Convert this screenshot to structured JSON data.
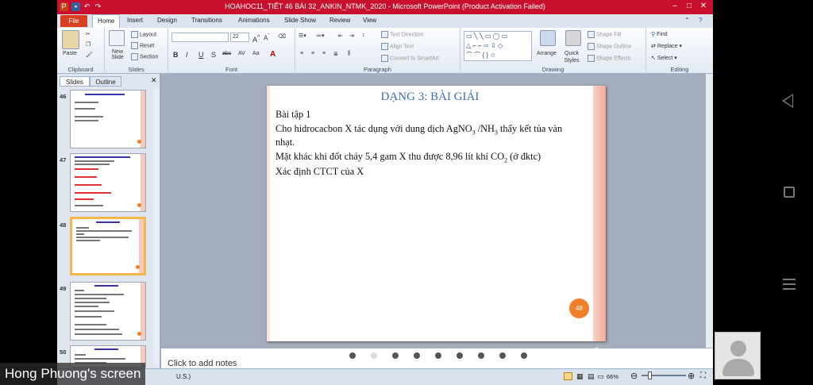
{
  "window": {
    "title": "HOAHOC11_TIẾT 46 BÀI 32_ANKIN_NTMK_2020 - Microsoft PowerPoint (Product Activation Failed)"
  },
  "ribbon_tabs": [
    "File",
    "Home",
    "Insert",
    "Design",
    "Transitions",
    "Animations",
    "Slide Show",
    "Review",
    "View"
  ],
  "ribbon": {
    "clipboard": {
      "paste": "Paste",
      "label": "Clipboard"
    },
    "slides": {
      "new_slide": "New Slide",
      "layout": "Layout",
      "reset": "Reset",
      "section": "Section",
      "label": "Slides"
    },
    "font": {
      "size": "22",
      "bold": "B",
      "italic": "I",
      "underline": "U",
      "strike": "S",
      "abc": "abc",
      "spacing": "AV",
      "case": "Aa",
      "label": "Font"
    },
    "paragraph": {
      "text_direction": "Text Direction",
      "align_text": "Align Text",
      "convert": "Convert to SmartArt",
      "label": "Paragraph"
    },
    "drawing": {
      "arrange": "Arrange",
      "quick_styles": "Quick Styles",
      "shape_fill": "Shape Fill",
      "shape_outline": "Shape Outline",
      "shape_effects": "Shape Effects",
      "label": "Drawing"
    },
    "editing": {
      "find": "Find",
      "replace": "Replace",
      "select": "Select",
      "label": "Editing"
    }
  },
  "panel": {
    "tabs": [
      "Slides",
      "Outline"
    ],
    "thumbnails": [
      {
        "num": "46",
        "selected": false
      },
      {
        "num": "47",
        "selected": false
      },
      {
        "num": "48",
        "selected": true
      },
      {
        "num": "49",
        "selected": false
      },
      {
        "num": "50",
        "selected": false
      }
    ]
  },
  "slide": {
    "title": "DẠNG 3: BÀI GIẢI",
    "line1": "Bài tập 1",
    "line2a": "Cho hidrocacbon X tác dụng với dung dịch AgNO",
    "line2sub1": "3",
    "line2b": " /NH",
    "line2sub2": "3",
    "line2c": " thấy kết tủa vàn",
    "line3": "nhạt.",
    "line4a": "Mặt khác khi đốt cháy 5,4 gam X thu được 8,96 lít khí CO",
    "line4sub": "2",
    "line4b": " (ở đktc)",
    "line5": "Xác định CTCT của X",
    "number": "48"
  },
  "notes": {
    "placeholder": "Click to add notes"
  },
  "status": {
    "lang": "U.S.)",
    "zoom": "66%"
  },
  "share": {
    "label": "Hong Phuong's screen"
  }
}
